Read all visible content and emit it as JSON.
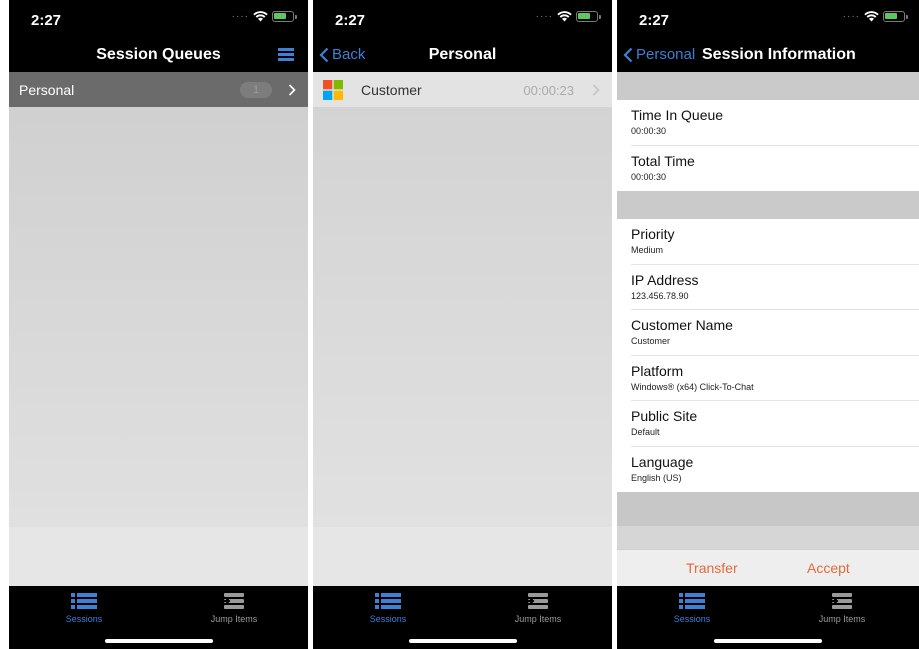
{
  "status": {
    "time": "2:27",
    "battery_color": "#5ec85e"
  },
  "accent": "#3f7fd4",
  "action_color": "#e26b3b",
  "tabs": [
    {
      "label": "Sessions",
      "icon": "list-icon",
      "active": true
    },
    {
      "label": "Jump Items",
      "icon": "jump-items-icon",
      "active": false
    }
  ],
  "screen1": {
    "title": "Session Queues",
    "menu_icon": "menu-icon",
    "queue": {
      "label": "Personal",
      "count": "1"
    }
  },
  "screen2": {
    "back_label": "Back",
    "title": "Personal",
    "session": {
      "label": "Customer",
      "time": "00:00:23",
      "icon": "windows-logo-icon"
    }
  },
  "screen3": {
    "back_label": "Personal",
    "title": "Session Information",
    "groups": [
      [
        {
          "label": "Time In Queue",
          "value": "00:00:30"
        },
        {
          "label": "Total Time",
          "value": "00:00:30"
        }
      ],
      [
        {
          "label": "Priority",
          "value": "Medium"
        },
        {
          "label": "IP Address",
          "value": "123.456.78.90"
        },
        {
          "label": "Customer Name",
          "value": "Customer"
        },
        {
          "label": "Platform",
          "value": "Windows® (x64) Click-To-Chat"
        },
        {
          "label": "Public Site",
          "value": "Default"
        },
        {
          "label": "Language",
          "value": "English (US)"
        }
      ]
    ],
    "actions": {
      "transfer": "Transfer",
      "accept": "Accept"
    }
  }
}
